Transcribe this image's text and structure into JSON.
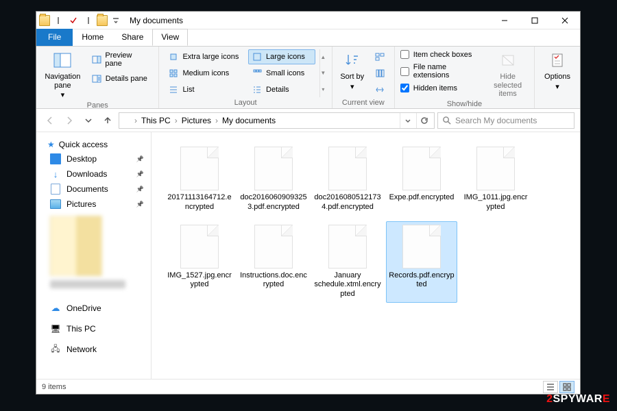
{
  "window": {
    "title": "My documents"
  },
  "tabs": {
    "file": "File",
    "home": "Home",
    "share": "Share",
    "view": "View"
  },
  "ribbon": {
    "panes": {
      "nav": "Navigation pane",
      "preview": "Preview pane",
      "details": "Details pane",
      "caption": "Panes"
    },
    "layout": {
      "xl": "Extra large icons",
      "lg": "Large icons",
      "md": "Medium icons",
      "sm": "Small icons",
      "list": "List",
      "details": "Details",
      "caption": "Layout"
    },
    "currentview": {
      "sort": "Sort by",
      "caption": "Current view"
    },
    "showhide": {
      "checkboxes": "Item check boxes",
      "extensions": "File name extensions",
      "hidden": "Hidden items",
      "hidesel": "Hide selected items",
      "caption": "Show/hide"
    },
    "options": {
      "label": "Options"
    }
  },
  "breadcrumb": [
    "This PC",
    "Pictures",
    "My documents"
  ],
  "search": {
    "placeholder": "Search My documents"
  },
  "sidebar": {
    "quick": "Quick access",
    "items": [
      {
        "label": "Desktop"
      },
      {
        "label": "Downloads"
      },
      {
        "label": "Documents"
      },
      {
        "label": "Pictures"
      }
    ],
    "onedrive": "OneDrive",
    "thispc": "This PC",
    "network": "Network"
  },
  "files": [
    {
      "name": "20171113164712.encrypted"
    },
    {
      "name": "doc20160609093253.pdf.encrypted"
    },
    {
      "name": "doc20160805121734.pdf.encrypted"
    },
    {
      "name": "Expe.pdf.encrypted"
    },
    {
      "name": "IMG_1011.jpg.encrypted"
    },
    {
      "name": "IMG_1527.jpg.encrypted"
    },
    {
      "name": "Instructions.doc.encrypted"
    },
    {
      "name": "January schedule.xtml.encrypted"
    },
    {
      "name": "Records.pdf.encrypted"
    }
  ],
  "status": {
    "count": "9 items"
  },
  "watermark": {
    "a": "2",
    "b": "SPYWAR",
    "c": "E"
  }
}
